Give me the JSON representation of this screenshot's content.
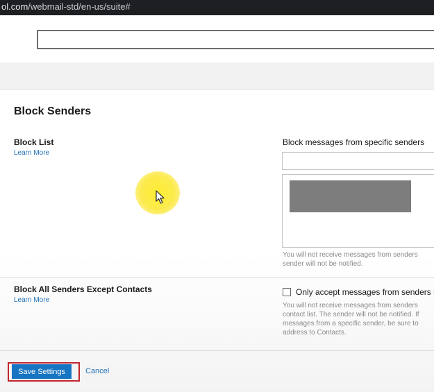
{
  "browser": {
    "url_host_partial": "ol.com",
    "url_path": "/webmail-std/en-us/suite#"
  },
  "page": {
    "title": "Block Senders"
  },
  "block_list": {
    "title": "Block List",
    "learn_more": "Learn More",
    "field_label": "Block messages from specific senders",
    "input_value": "",
    "note_line1": "You will not receive messages from senders",
    "note_line2": "sender will not be notified."
  },
  "block_all": {
    "title": "Block All Senders Except Contacts",
    "learn_more": "Learn More",
    "checkbox_label": "Only accept messages from senders in y",
    "checkbox_checked": false,
    "note_line1": "You will not receive messages from senders",
    "note_line2": "contact list. The sender will not be notified. If",
    "note_line3": "messages from a specific sender, be sure to",
    "note_line4": "address to Contacts."
  },
  "actions": {
    "save_label": "Save Settings",
    "cancel_label": "Cancel"
  },
  "colors": {
    "accent_blue": "#1774c2",
    "link_blue": "#1f6fb5",
    "highlight_outline": "#c0262d",
    "cursor_highlight": "#f7e52a"
  },
  "icons": {
    "pointer": "mouse-pointer-icon"
  }
}
